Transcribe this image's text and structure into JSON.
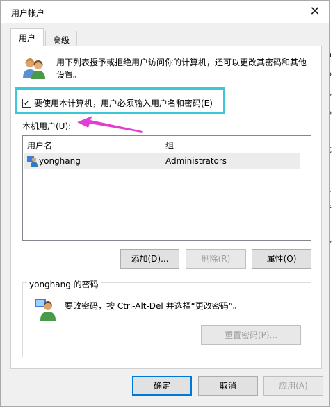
{
  "dialog": {
    "title": "用户帐户"
  },
  "tabs": [
    {
      "label": "用户"
    },
    {
      "label": "高级"
    }
  ],
  "intro_text": "用下列表授予或拒绝用户访问你的计算机，还可以更改其密码和其他设置。",
  "require_login": {
    "label": "要使用本计算机，用户必须输入用户名和密码(E)",
    "checked": true
  },
  "local_users": {
    "label": "本机用户(U):",
    "columns": [
      "用户名",
      "组"
    ],
    "rows": [
      {
        "name": "yonghang",
        "group": "Administrators"
      }
    ]
  },
  "user_buttons": {
    "add": "添加(D)...",
    "remove": "删除(R)",
    "properties": "属性(O)"
  },
  "password_group": {
    "title": "yonghang 的密码",
    "text": "要改密码，按 Ctrl-Alt-Del 并选择“更改密码”。",
    "reset_button": "重置密码(P)..."
  },
  "footer_buttons": {
    "ok": "确定",
    "cancel": "取消",
    "apply": "应用(A)"
  },
  "colors": {
    "highlight": "#3cc8d6",
    "arrow": "#e23ed0",
    "default_button_border": "#0078d7"
  }
}
